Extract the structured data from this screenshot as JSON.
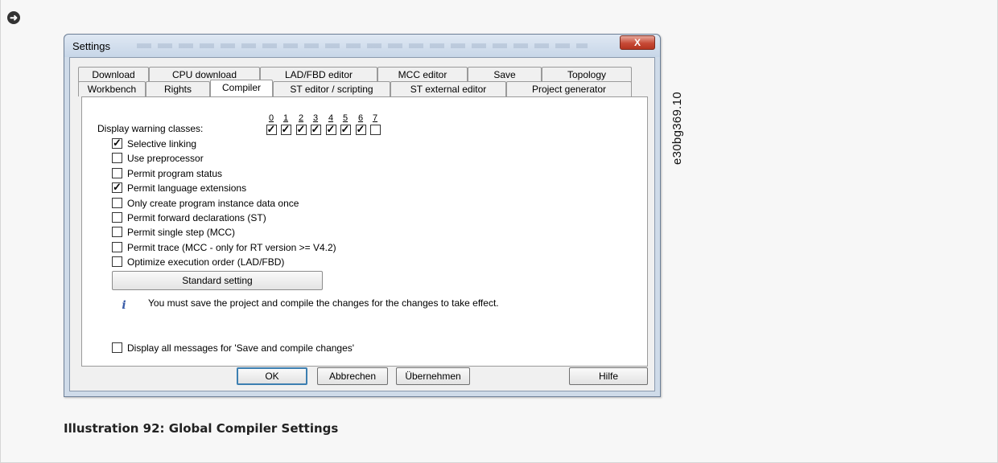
{
  "document": {
    "figure_code": "e30bg369.10",
    "caption": "Illustration 92: Global Compiler Settings"
  },
  "dialog": {
    "title": "Settings",
    "close_label": "X",
    "tabs_row1": [
      "Download",
      "CPU download",
      "LAD/FBD editor",
      "MCC editor",
      "Save",
      "Topology"
    ],
    "tabs_row2": [
      "Workbench",
      "Rights",
      "Compiler",
      "ST editor / scripting",
      "ST external editor",
      "Project generator"
    ],
    "active_tab": "Compiler",
    "warning_classes": {
      "label": "Display warning classes:",
      "classes": [
        {
          "num": "0",
          "checked": true
        },
        {
          "num": "1",
          "checked": true
        },
        {
          "num": "2",
          "checked": true
        },
        {
          "num": "3",
          "checked": true
        },
        {
          "num": "4",
          "checked": true
        },
        {
          "num": "5",
          "checked": true
        },
        {
          "num": "6",
          "checked": true
        },
        {
          "num": "7",
          "checked": false
        }
      ]
    },
    "options": [
      {
        "label": "Selective linking",
        "checked": true
      },
      {
        "label": "Use preprocessor",
        "checked": false
      },
      {
        "label": "Permit program status",
        "checked": false
      },
      {
        "label": "Permit language extensions",
        "checked": true
      },
      {
        "label": "Only create program instance data once",
        "checked": false
      },
      {
        "label": "Permit forward declarations (ST)",
        "checked": false
      },
      {
        "label": "Permit single step (MCC)",
        "checked": false
      },
      {
        "label": "Permit trace (MCC - only for RT version >= V4.2)",
        "checked": false
      },
      {
        "label": "Optimize execution order (LAD/FBD)",
        "checked": false
      }
    ],
    "standard_button": "Standard setting",
    "info_text": "You must save the project and compile the changes for the changes to take effect.",
    "display_all_messages": {
      "label": "Display all messages for 'Save and compile changes'",
      "checked": false
    },
    "buttons": {
      "ok": "OK",
      "cancel": "Abbrechen",
      "apply": "Übernehmen",
      "help": "Hilfe"
    }
  }
}
